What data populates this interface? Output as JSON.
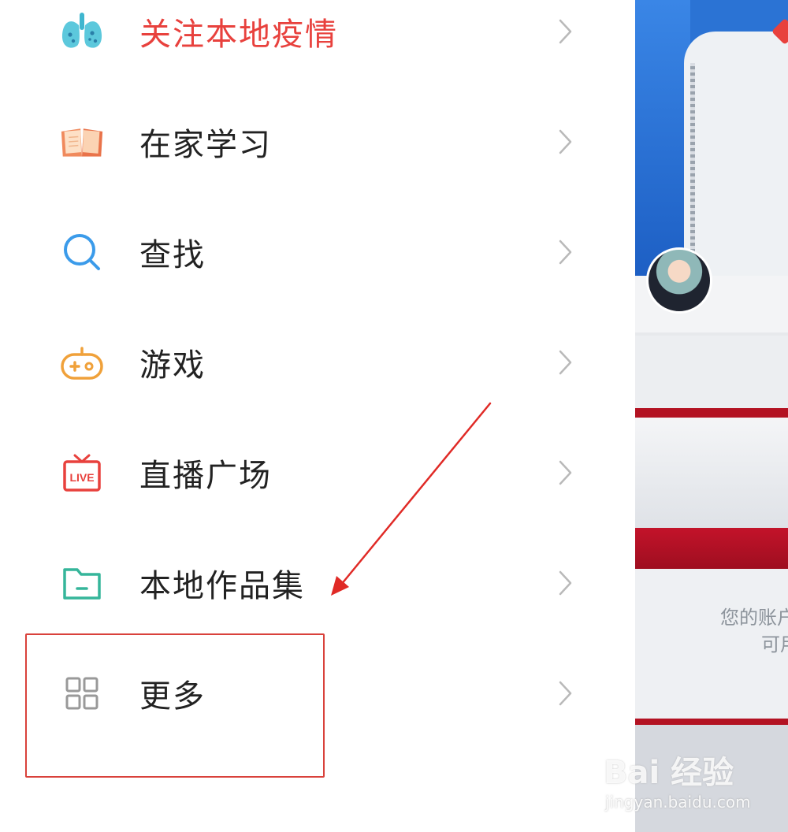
{
  "menu": {
    "items": [
      {
        "label": "关注本地疫情",
        "icon": "lungs-icon",
        "accent": "#e8413d"
      },
      {
        "label": "在家学习",
        "icon": "book-icon"
      },
      {
        "label": "查找",
        "icon": "search-icon"
      },
      {
        "label": "游戏",
        "icon": "gamepad-icon"
      },
      {
        "label": "直播广场",
        "icon": "live-tv-icon",
        "badge": "LIVE"
      },
      {
        "label": "本地作品集",
        "icon": "folder-icon"
      },
      {
        "label": "更多",
        "icon": "grid-icon"
      }
    ],
    "chevron_icon": "chevron-right-icon"
  },
  "annotation": {
    "highlight_color": "#d9413b",
    "arrow_color": "#e02a26"
  },
  "preview": {
    "account_text_line1": "您的账户",
    "account_text_line2": "可用"
  },
  "watermark": {
    "logo": "Bai 经验",
    "url": "jingyan.baidu.com"
  }
}
